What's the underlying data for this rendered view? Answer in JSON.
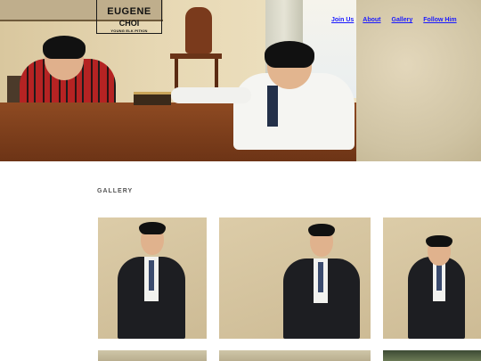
{
  "logo": {
    "line1": "EUGENE",
    "line2": "CHOI",
    "tagline": "YOUNG ELK PITKIN"
  },
  "nav": {
    "items": [
      {
        "label": "Join Us"
      },
      {
        "label": "About"
      },
      {
        "label": "Gallery"
      },
      {
        "label": "Follow Him"
      }
    ]
  },
  "gallery": {
    "title": "GALLERY"
  },
  "colors": {
    "nav_link": "#1a1aff",
    "table_wood": "#8e4a22",
    "wall_beige": "#d9c9a4"
  },
  "icons": []
}
